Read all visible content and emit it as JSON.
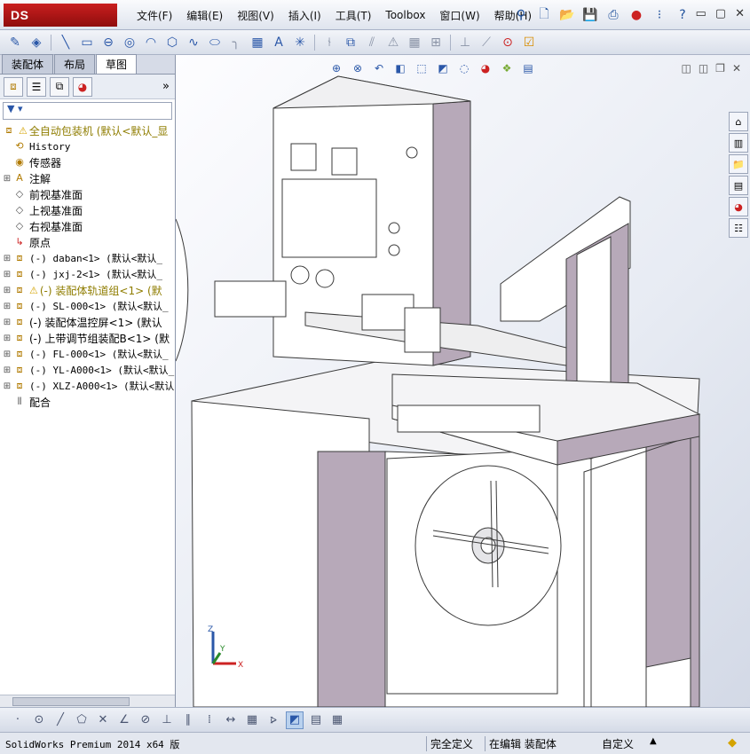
{
  "app": {
    "logo": "DS SOLIDWORKS"
  },
  "menu": [
    "文件(F)",
    "编辑(E)",
    "视图(V)",
    "插入(I)",
    "工具(T)",
    "Toolbox",
    "窗口(W)",
    "帮助(H)"
  ],
  "window_controls": [
    "▭",
    "▢",
    "✕"
  ],
  "panel_tabs": [
    "装配体",
    "布局",
    "草图"
  ],
  "tree": {
    "root": "全自动包装机  (默认<默认_显",
    "items": [
      {
        "label": "History",
        "mono": true
      },
      {
        "label": "传感器"
      },
      {
        "label": "注解"
      },
      {
        "label": "前视基准面"
      },
      {
        "label": "上视基准面"
      },
      {
        "label": "右视基准面"
      },
      {
        "label": "原点"
      },
      {
        "label": "(-) daban<1> (默认<默认_",
        "mono": true
      },
      {
        "label": "(-) jxj-2<1> (默认<默认_",
        "mono": true
      },
      {
        "label": "(-) 装配体轨道组<1> (默",
        "warn": true
      },
      {
        "label": "(-) SL-000<1> (默认<默认_",
        "mono": true
      },
      {
        "label": "(-) 装配体温控屏<1> (默认"
      },
      {
        "label": "(-) 上带调节组装配B<1> (默"
      },
      {
        "label": "(-) FL-000<1> (默认<默认_",
        "mono": true
      },
      {
        "label": "(-) YL-A000<1> (默认<默认_",
        "mono": true
      },
      {
        "label": "(-) XLZ-A000<1> (默认<默认",
        "mono": true
      },
      {
        "label": "配合"
      }
    ]
  },
  "status": {
    "product": "SolidWorks Premium 2014 x64 版",
    "definition": "完全定义",
    "editing": "在编辑 装配体",
    "units": "自定义"
  },
  "triad": {
    "x": "X",
    "y": "Y",
    "z": "Z"
  }
}
